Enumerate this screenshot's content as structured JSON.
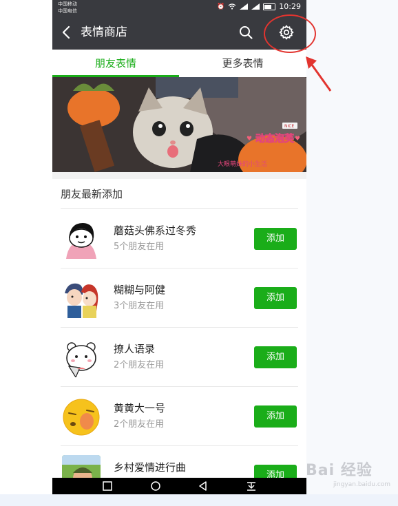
{
  "status_bar": {
    "carrier_1": "中国移动",
    "carrier_2": "中国电信",
    "time": "10:29"
  },
  "header": {
    "title": "表情商店",
    "back_icon": "chevron-left-icon",
    "search_icon": "search-icon",
    "settings_icon": "gear-icon"
  },
  "tabs": [
    {
      "label": "朋友表情",
      "active": true
    },
    {
      "label": "更多表情",
      "active": false
    }
  ],
  "banner": {
    "caption": "动态泡芙",
    "subcaption": "大眼萌妹的小生活",
    "tag": "NICE"
  },
  "section": {
    "title": "朋友最新添加"
  },
  "items": [
    {
      "name": "蘑菇头佛系过冬秀",
      "sub": "5个朋友在用",
      "button": "添加"
    },
    {
      "name": "糊糊与阿健",
      "sub": "3个朋友在用",
      "button": "添加"
    },
    {
      "name": "撩人语录",
      "sub": "2个朋友在用",
      "button": "添加"
    },
    {
      "name": "黄黄大一号",
      "sub": "2个朋友在用",
      "button": "添加"
    },
    {
      "name": "乡村爱情进行曲",
      "sub": "",
      "button": "添加"
    }
  ],
  "watermark": {
    "text": "Bai 经验",
    "sub": "jingyan.baidu.com"
  },
  "colors": {
    "accent_green": "#1aad19",
    "nav_dark": "#393a3f",
    "annotation_red": "#e2342f"
  }
}
